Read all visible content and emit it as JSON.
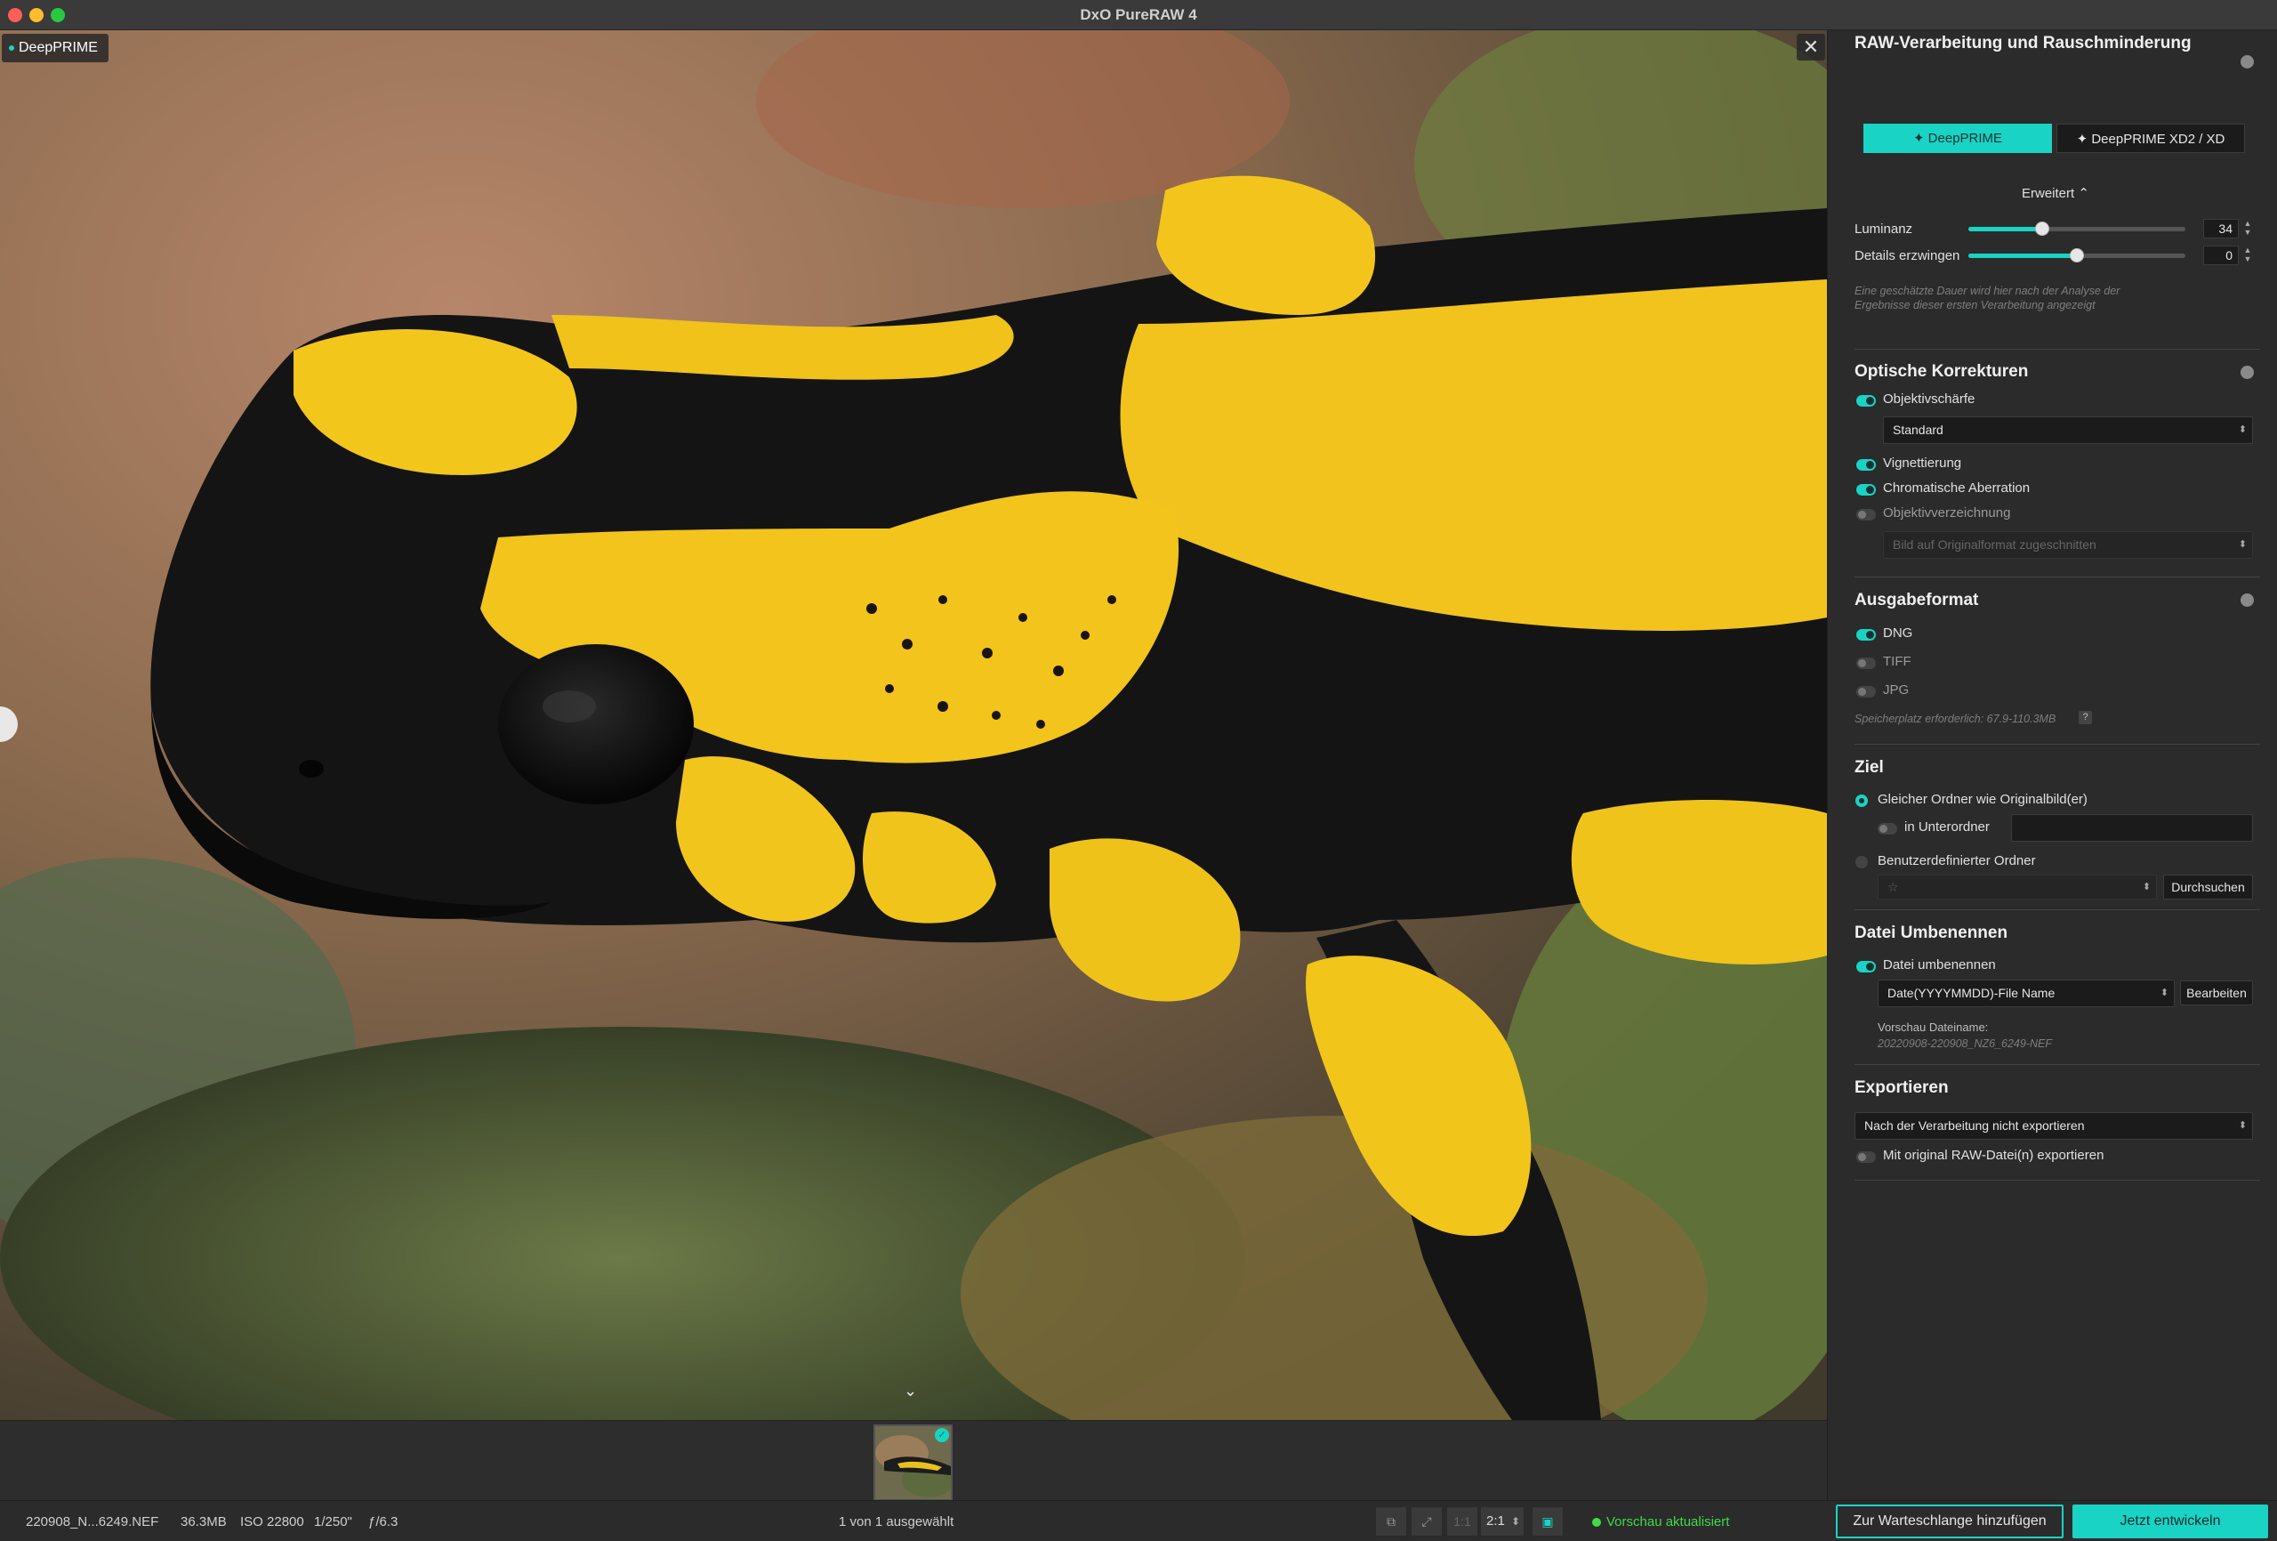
{
  "window": {
    "title": "DxO PureRAW 4"
  },
  "viewer": {
    "mode_badge": "DeepPRIME",
    "close_glyph": "✕",
    "collapse_glyph": "⌄"
  },
  "panel": {
    "raw": {
      "title": "RAW-Verarbeitung und Rauschminderung",
      "seg_deepprime": "✦ DeepPRIME",
      "seg_xd": "✦ DeepPRIME XD2 / XD",
      "advanced_toggle": "Erweitert ⌃",
      "luminance_label": "Luminanz",
      "luminance_value": "34",
      "luminance_fraction": 0.34,
      "details_label": "Details erzwingen",
      "details_value": "0",
      "details_fraction": 0.5,
      "duration_note": "Eine geschätzte Dauer wird hier nach der Analyse der Ergebnisse dieser ersten Verarbeitung angezeigt"
    },
    "optics": {
      "title": "Optische Korrekturen",
      "sharpness_label": "Objektivschärfe",
      "sharpness_select": "Standard",
      "vignetting_label": "Vignettierung",
      "chromatic_label": "Chromatische Aberration",
      "distortion_label": "Objektivverzeichnung",
      "distortion_select": "Bild auf Originalformat zugeschnitten"
    },
    "output": {
      "title": "Ausgabeformat",
      "dng": "DNG",
      "tiff": "TIFF",
      "jpg": "JPG",
      "storage_note": "Speicherplatz erforderlich: 67.9-110.3MB",
      "help_glyph": "?"
    },
    "destination": {
      "title": "Ziel",
      "same_folder": "Gleicher Ordner wie Originalbild(er)",
      "subfolder": "in Unterordner",
      "custom_folder": "Benutzerdefinierter Ordner",
      "browse": "Durchsuchen",
      "star_glyph": "☆"
    },
    "rename": {
      "title": "Datei Umbenennen",
      "rename_label": "Datei umbenennen",
      "pattern_select": "Date(YYYYMMDD)-File Name",
      "edit": "Bearbeiten",
      "preview_label": "Vorschau Dateiname:",
      "preview_value": "20220908-220908_NZ6_6249-NEF"
    },
    "export": {
      "title": "Exportieren",
      "export_select": "Nach der Verarbeitung nicht exportieren",
      "with_raw_label": "Mit original RAW-Datei(n) exportieren"
    }
  },
  "status": {
    "filename": "220908_N...6249.NEF",
    "size": "36.3MB",
    "iso": "ISO 22800",
    "shutter": "1/250\"",
    "aperture": "ƒ/6.3",
    "selection": "1 von 1 ausgewählt",
    "view_one_to_one": "1:1",
    "zoom": "2:1",
    "preview_status": "Vorschau aktualisiert",
    "add_queue": "Zur Warteschlange hinzufügen",
    "develop_now": "Jetzt entwickeln"
  },
  "colors": {
    "accent": "#19d3c5",
    "status_ok": "#3fdc4a"
  },
  "icons": [
    "close-icon",
    "chevron-down-icon",
    "sparkle-icon",
    "help-icon",
    "star-icon",
    "compare-icon",
    "fit-icon",
    "preview-icon"
  ]
}
